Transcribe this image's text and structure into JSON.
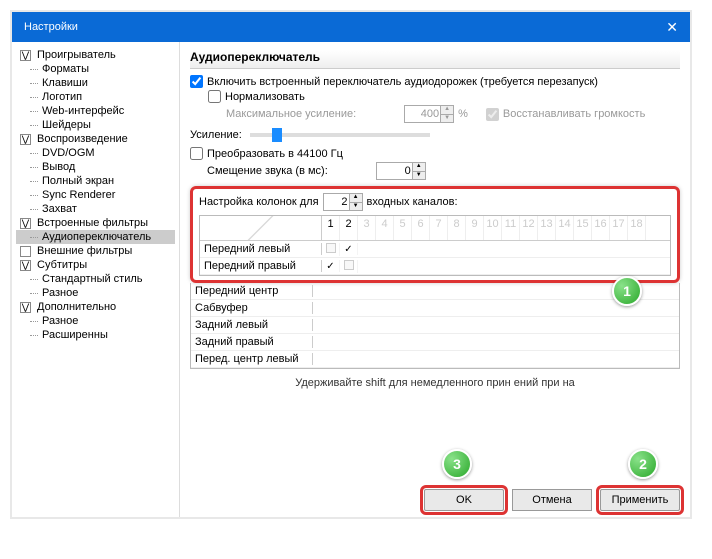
{
  "window": {
    "title": "Настройки",
    "close": "✕"
  },
  "tree": [
    {
      "label": "Проигрыватель",
      "expand": "⋁",
      "level": 1
    },
    {
      "label": "Форматы",
      "level": 2
    },
    {
      "label": "Клавиши",
      "level": 2
    },
    {
      "label": "Логотип",
      "level": 2
    },
    {
      "label": "Web-интерфейс",
      "level": 2
    },
    {
      "label": "Шейдеры",
      "level": 2
    },
    {
      "label": "Воспроизведение",
      "expand": "⋁",
      "level": 1
    },
    {
      "label": "DVD/OGM",
      "level": 2
    },
    {
      "label": "Вывод",
      "level": 2
    },
    {
      "label": "Полный экран",
      "level": 2
    },
    {
      "label": "Sync Renderer",
      "level": 2
    },
    {
      "label": "Захват",
      "level": 2
    },
    {
      "label": "Встроенные фильтры",
      "expand": "⋁",
      "level": 1
    },
    {
      "label": "Аудиопереключатель",
      "level": 2,
      "selected": true
    },
    {
      "label": "Внешние фильтры",
      "expand": "",
      "level": 1
    },
    {
      "label": "Субтитры",
      "expand": "⋁",
      "level": 1
    },
    {
      "label": "Стандартный стиль",
      "level": 2
    },
    {
      "label": "Разное",
      "level": 2
    },
    {
      "label": "Дополнительно",
      "expand": "⋁",
      "level": 1
    },
    {
      "label": "Разное",
      "level": 2
    },
    {
      "label": "Расширенны",
      "level": 2
    }
  ],
  "section": {
    "title": "Аудиопереключатель"
  },
  "enable": {
    "label": "Включить встроенный переключатель аудиодорожек (требуется перезапуск)"
  },
  "normalize": {
    "label": "Нормализовать"
  },
  "maxgain": {
    "label": "Максимальное усиление:",
    "value": "400",
    "unit": "%"
  },
  "restore": {
    "label": "Восстанавливать громкость"
  },
  "gain": {
    "label": "Усиление:"
  },
  "convert": {
    "label": "Преобразовать в 44100 Гц"
  },
  "offset": {
    "label": "Смещение звука (в мс):",
    "value": "0"
  },
  "speakers": {
    "prefix": "Настройка колонок для",
    "value": "2",
    "suffix": "входных каналов:"
  },
  "matrix": {
    "cols_active": [
      "1",
      "2"
    ],
    "cols_ext": [
      "3",
      "4",
      "5",
      "6",
      "7",
      "8",
      "9",
      "10",
      "11",
      "12",
      "13",
      "14",
      "15",
      "16",
      "17",
      "18"
    ],
    "rows": [
      {
        "label": "Передний левый",
        "cells": [
          "box",
          "chk"
        ]
      },
      {
        "label": "Передний правый",
        "cells": [
          "chk",
          "box"
        ]
      },
      {
        "label": "Передний центр",
        "cells": [
          "",
          ""
        ]
      },
      {
        "label": "Сабвуфер",
        "cells": [
          "",
          ""
        ]
      },
      {
        "label": "Задний левый",
        "cells": [
          "",
          ""
        ]
      },
      {
        "label": "Задний правый",
        "cells": [
          "",
          ""
        ]
      },
      {
        "label": "Перед. центр левый",
        "cells": [
          "",
          ""
        ]
      }
    ]
  },
  "hint": "Удерживайте shift для немедленного прин                         ений при на",
  "buttons": {
    "ok": "OK",
    "cancel": "Отмена",
    "apply": "Применить"
  },
  "badges": {
    "b1": "1",
    "b2": "2",
    "b3": "3"
  }
}
